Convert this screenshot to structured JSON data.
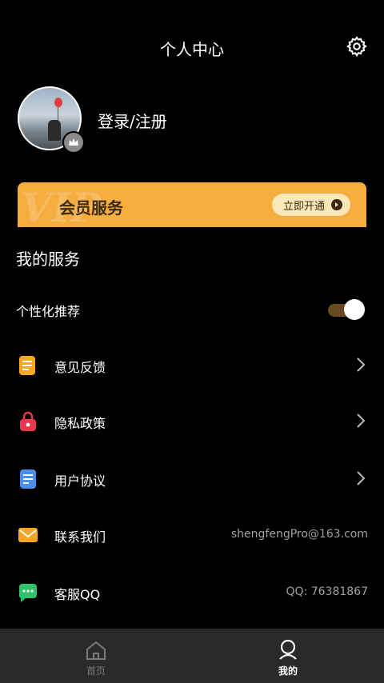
{
  "header": {
    "title": "个人中心",
    "settings_icon": "gear-icon"
  },
  "profile": {
    "login_label": "登录/注册",
    "badge_icon": "crown-icon"
  },
  "vip": {
    "watermark": "VIP",
    "title": "会员服务",
    "button_label": "立即开通",
    "accent": "#f6ad40"
  },
  "services": {
    "title": "我的服务",
    "personalized": {
      "label": "个性化推荐",
      "enabled": true
    },
    "items": [
      {
        "label": "意见反馈",
        "icon": "feedback-icon",
        "color": "#f5a623"
      },
      {
        "label": "隐私政策",
        "icon": "lock-icon",
        "color": "#e8384f"
      },
      {
        "label": "用户协议",
        "icon": "document-icon",
        "color": "#4a8ef0"
      },
      {
        "label": "联系我们",
        "icon": "mail-icon",
        "color": "#f5a623",
        "extra": "shengfengPro@163.com"
      },
      {
        "label": "客服QQ",
        "icon": "chat-icon",
        "color": "#2fc36b",
        "extra": "QQ: 76381867"
      }
    ]
  },
  "tabs": [
    {
      "label": "首页",
      "icon": "home-icon",
      "active": false
    },
    {
      "label": "我的",
      "icon": "user-icon",
      "active": true
    }
  ]
}
